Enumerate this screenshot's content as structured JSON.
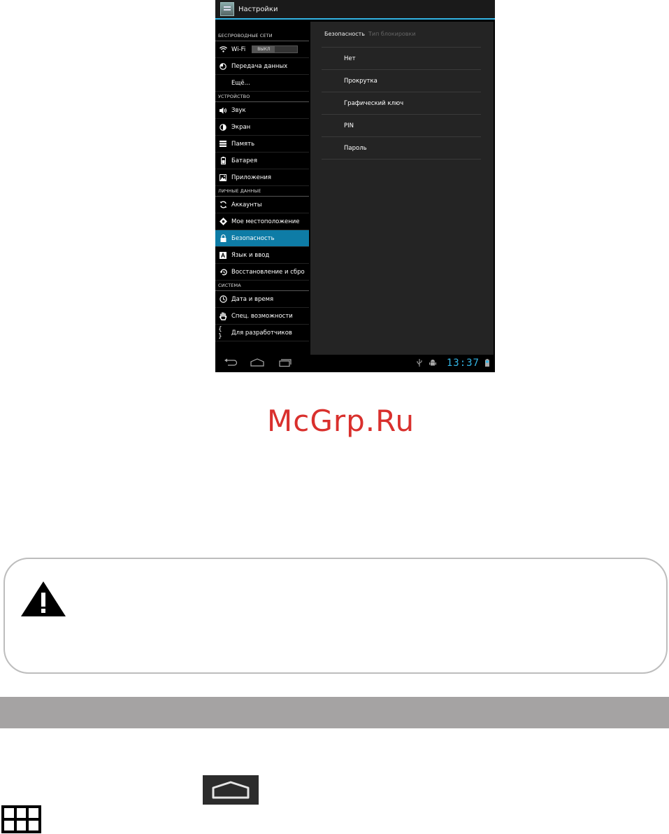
{
  "device": {
    "actionbar": {
      "title": "Настройки"
    },
    "sidebar": {
      "sections": [
        {
          "header": "БЕСПРОВОДНЫЕ СЕТИ",
          "items": [
            {
              "label": "Wi-Fi",
              "icon": "wifi-icon",
              "toggle": "ВЫКЛ"
            },
            {
              "label": "Передача данных",
              "icon": "data-usage-icon"
            },
            {
              "label": "Ещё...",
              "icon": ""
            }
          ]
        },
        {
          "header": "УСТРОЙСТВО",
          "items": [
            {
              "label": "Звук",
              "icon": "sound-icon"
            },
            {
              "label": "Экран",
              "icon": "display-icon"
            },
            {
              "label": "Память",
              "icon": "storage-icon"
            },
            {
              "label": "Батарея",
              "icon": "battery-icon"
            },
            {
              "label": "Приложения",
              "icon": "apps-icon"
            }
          ]
        },
        {
          "header": "ЛИЧНЫЕ ДАННЫЕ",
          "items": [
            {
              "label": "Аккаунты",
              "icon": "sync-icon"
            },
            {
              "label": "Мое местоположение",
              "icon": "location-icon"
            },
            {
              "label": "Безопасность",
              "icon": "lock-icon",
              "active": true
            },
            {
              "label": "Язык и ввод",
              "icon": "language-icon"
            },
            {
              "label": "Восстановление и сбро",
              "icon": "restore-icon"
            }
          ]
        },
        {
          "header": "СИСТЕМА",
          "items": [
            {
              "label": "Дата и время",
              "icon": "clock-icon"
            },
            {
              "label": "Спец. возможности",
              "icon": "hand-icon"
            },
            {
              "label": "Для разработчиков",
              "icon": "braces-icon"
            }
          ]
        }
      ]
    },
    "panel": {
      "breadcrumb": [
        "Безопасность",
        "Тип блокировки"
      ],
      "options": [
        "Нет",
        "Прокрутка",
        "Графический ключ",
        "PIN",
        "Пароль"
      ]
    },
    "navbar": {
      "clock": "13:37"
    }
  },
  "watermark": "McGrp.Ru",
  "colors": {
    "accent": "#33b5e5",
    "active_item": "#0e7ca6",
    "watermark": "#d9302d"
  }
}
